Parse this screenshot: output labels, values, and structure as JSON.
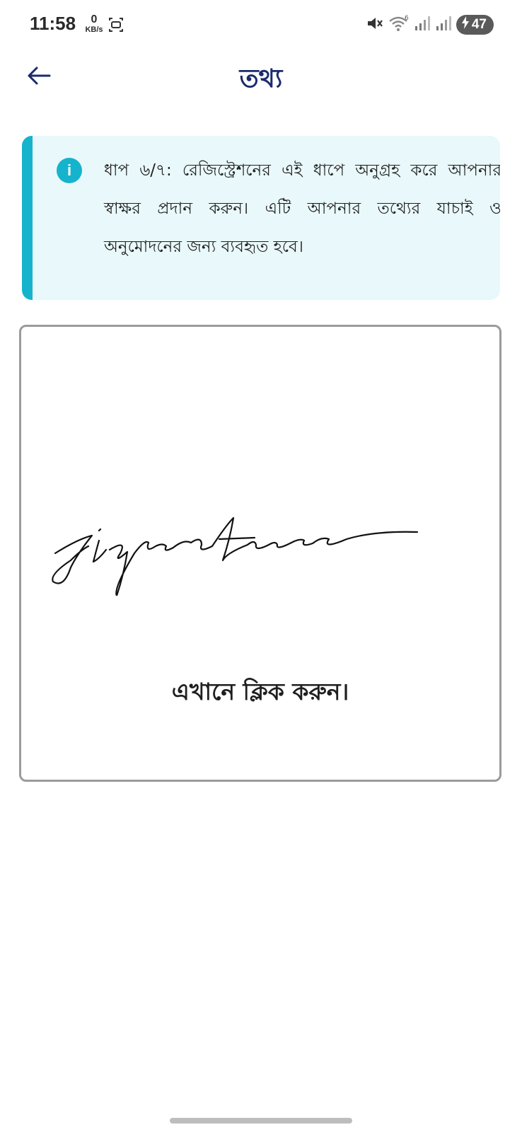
{
  "status_bar": {
    "time": "11:58",
    "net_speed_value": "0",
    "net_speed_unit": "KB/s",
    "battery_level": "47",
    "icons": [
      "screen-record-icon",
      "mute-icon",
      "wifi-icon",
      "signal-icon",
      "signal-icon",
      "charging-icon"
    ]
  },
  "header": {
    "title": "তথ্য",
    "back_icon": "arrow-left-icon"
  },
  "info_banner": {
    "icon_glyph": "i",
    "text": "ধাপ ৬/৭: রেজিস্ট্রেশনের এই ধাপে অনুগ্রহ করে আপনার স্বাক্ষর প্রদান করুন। এটি আপনার তথ্যের যাচাই ও অনুমোদনের জন্য ব্যবহৃত হবে।",
    "accent_color": "#16b3cc",
    "background_color": "#e9f8fa"
  },
  "signature_pad": {
    "label": "এখানে ক্লিক করুন।"
  },
  "colors": {
    "title": "#1a2a6c",
    "pad_border": "#9b9b9b"
  }
}
